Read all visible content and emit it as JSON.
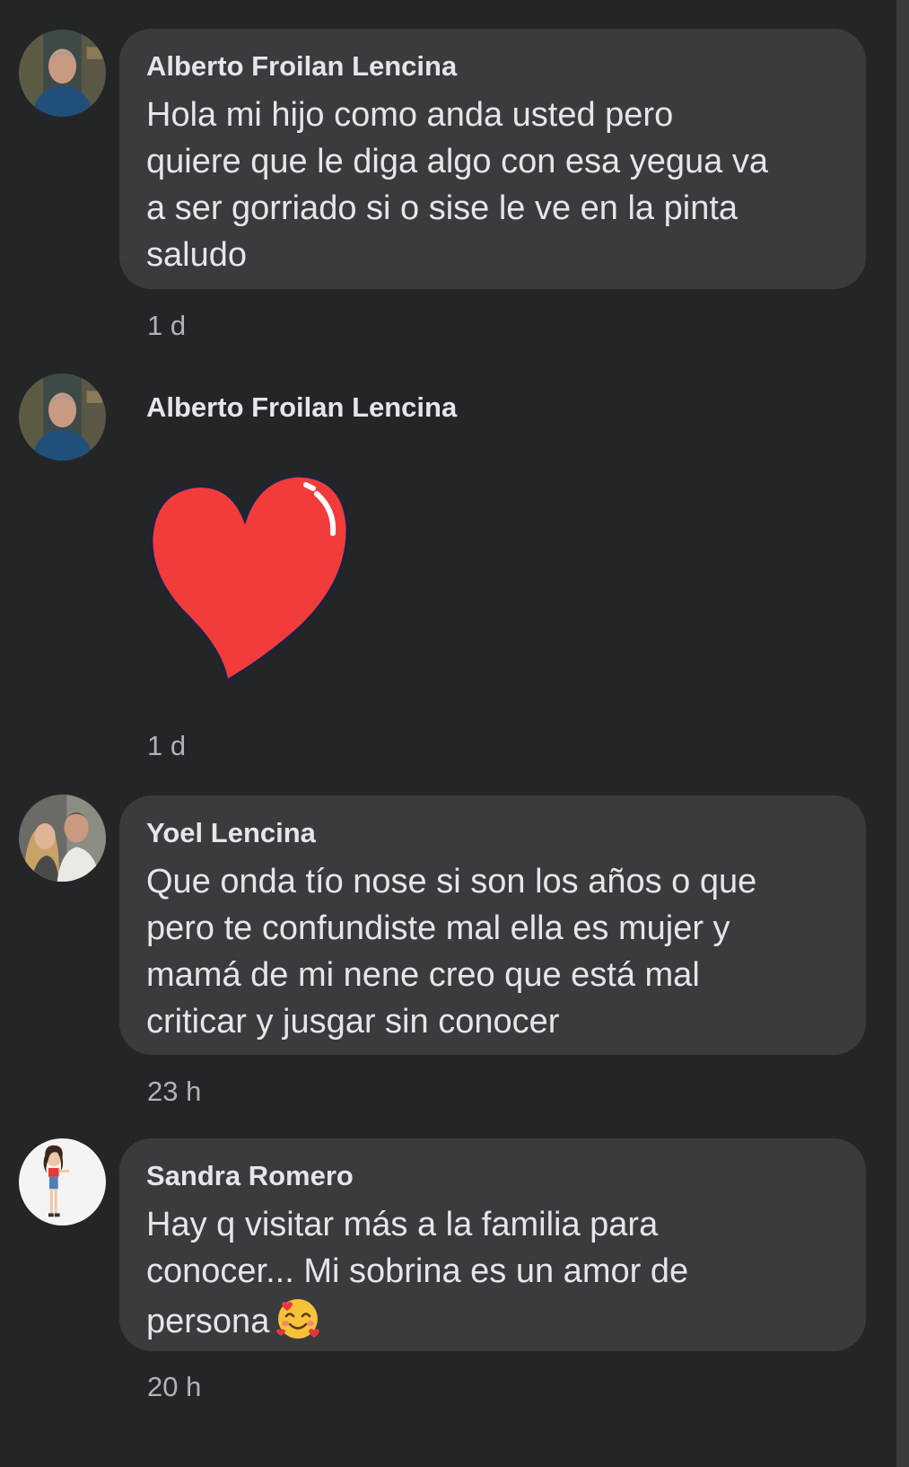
{
  "comments": [
    {
      "author": "Alberto Froilan Lencina",
      "text": "Hola mi hijo como anda usted pero\nquiere que le diga algo con esa yegua va\na ser gorriado si o sise le ve en la pinta\nsaludo",
      "time": "1 d",
      "avatar": "man-portrait-avatar"
    },
    {
      "author": "Alberto Froilan Lencina",
      "sticker": "red-heart-sticker",
      "sticker_color": "#f23c3c",
      "time": "1 d",
      "avatar": "man-portrait-avatar"
    },
    {
      "author": "Yoel Lencina",
      "text": "Que onda tío nose si  son los años o que\npero te confundiste mal ella es mujer y\nmamá de mi nene  creo que está mal\ncriticar y jusgar sin conocer",
      "time": "23 h",
      "avatar": "couple-avatar"
    },
    {
      "author": "Sandra Romero",
      "text": "Hay q visitar más a la familia para\nconocer... Mi sobrina es un  amor de\npersona",
      "emoji": "smiling-face-with-hearts-emoji",
      "time": "20 h",
      "avatar": "cartoon-girl-avatar"
    }
  ],
  "colors": {
    "background": "#242527",
    "bubble": "#3a3b3c",
    "text": "#e4e6eb",
    "secondary_text": "#b0b3b8"
  }
}
